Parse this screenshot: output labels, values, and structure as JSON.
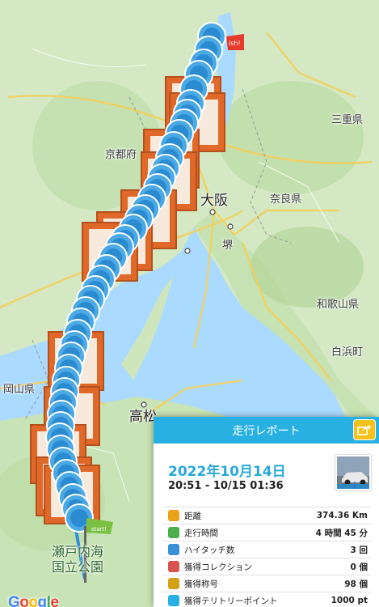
{
  "map": {
    "labels": {
      "kyoto": "京都府",
      "osaka": "大阪",
      "sakai": "堺",
      "nara": "奈良県",
      "mie": "三重県",
      "wakayama": "和歌山県",
      "shirahama": "白浜町",
      "okayama": "岡山県",
      "takamatsu": "高松",
      "seto_park": "瀬戸内海\n国立公園"
    },
    "start_flag": "start!",
    "goal_flag": "ish!",
    "google": [
      "G",
      "o",
      "o",
      "g",
      "l",
      "e"
    ],
    "google_colors": [
      "#4285f4",
      "#ea4335",
      "#fbbc05",
      "#4285f4",
      "#34a853",
      "#ea4335"
    ]
  },
  "report": {
    "title": "走行レポート",
    "date": "2022年10月14日",
    "time_range": "20:51 - 10/15 01:36",
    "stats": [
      {
        "icon": "distance-icon",
        "label": "距離",
        "value": "374.36 Km",
        "color": "#e8a317"
      },
      {
        "icon": "clock-icon",
        "label": "走行時間",
        "value": "4 時間 45 分",
        "color": "#4cae4c"
      },
      {
        "icon": "hand-icon",
        "label": "ハイタッチ数",
        "value": "3 回",
        "color": "#3b8fd6"
      },
      {
        "icon": "collection-icon",
        "label": "獲得コレクション",
        "value": "0 個",
        "color": "#d9534f"
      },
      {
        "icon": "medal-icon",
        "label": "獲得称号",
        "value": "98 個",
        "color": "#d4a017"
      },
      {
        "icon": "territory-icon",
        "label": "獲得テリトリーポイント",
        "value": "1000 pt",
        "color": "#29b0e3"
      }
    ]
  }
}
